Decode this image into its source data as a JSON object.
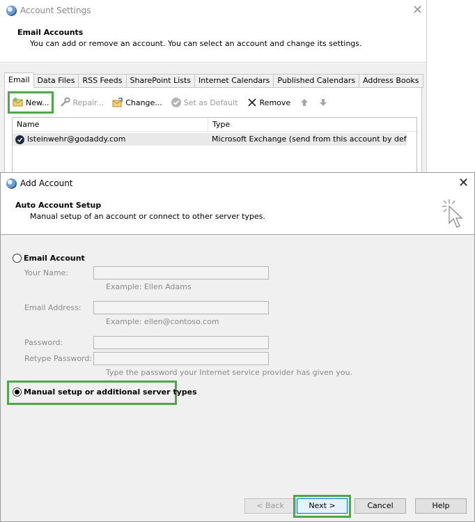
{
  "account_settings": {
    "title": "Account Settings",
    "header_title": "Email Accounts",
    "header_subtitle": "You can add or remove an account. You can select an account and change its settings.",
    "tabs": [
      {
        "label": "Email",
        "active": true
      },
      {
        "label": "Data Files"
      },
      {
        "label": "RSS Feeds"
      },
      {
        "label": "SharePoint Lists"
      },
      {
        "label": "Internet Calendars"
      },
      {
        "label": "Published Calendars"
      },
      {
        "label": "Address Books"
      }
    ],
    "toolbar": {
      "new": "New...",
      "repair": "Repair...",
      "change": "Change...",
      "set_default": "Set as Default",
      "remove": "Remove"
    },
    "list": {
      "columns": [
        "Name",
        "Type"
      ],
      "rows": [
        {
          "name": "lsteinwehr@godaddy.com",
          "type": "Microsoft Exchange (send from this account by def..."
        }
      ]
    }
  },
  "add_account": {
    "title": "Add Account",
    "header_title": "Auto Account Setup",
    "header_subtitle": "Manual setup of an account or connect to other server types.",
    "email_account": {
      "label": "Email Account",
      "selected": false,
      "fields": {
        "name_label": "Your Name:",
        "name_hint": "Example: Ellen Adams",
        "email_label": "Email Address:",
        "email_hint": "Example: ellen@contoso.com",
        "password_label": "Password:",
        "retype_label": "Retype Password:",
        "password_hint": "Type the password your Internet service provider has given you."
      }
    },
    "manual_setup": {
      "label": "Manual setup or additional server types",
      "selected": true
    },
    "buttons": {
      "back": "< Back",
      "next": "Next >",
      "cancel": "Cancel",
      "help": "Help"
    }
  },
  "colors": {
    "highlight": "#4ea84a",
    "primary_border": "#0078d7"
  }
}
